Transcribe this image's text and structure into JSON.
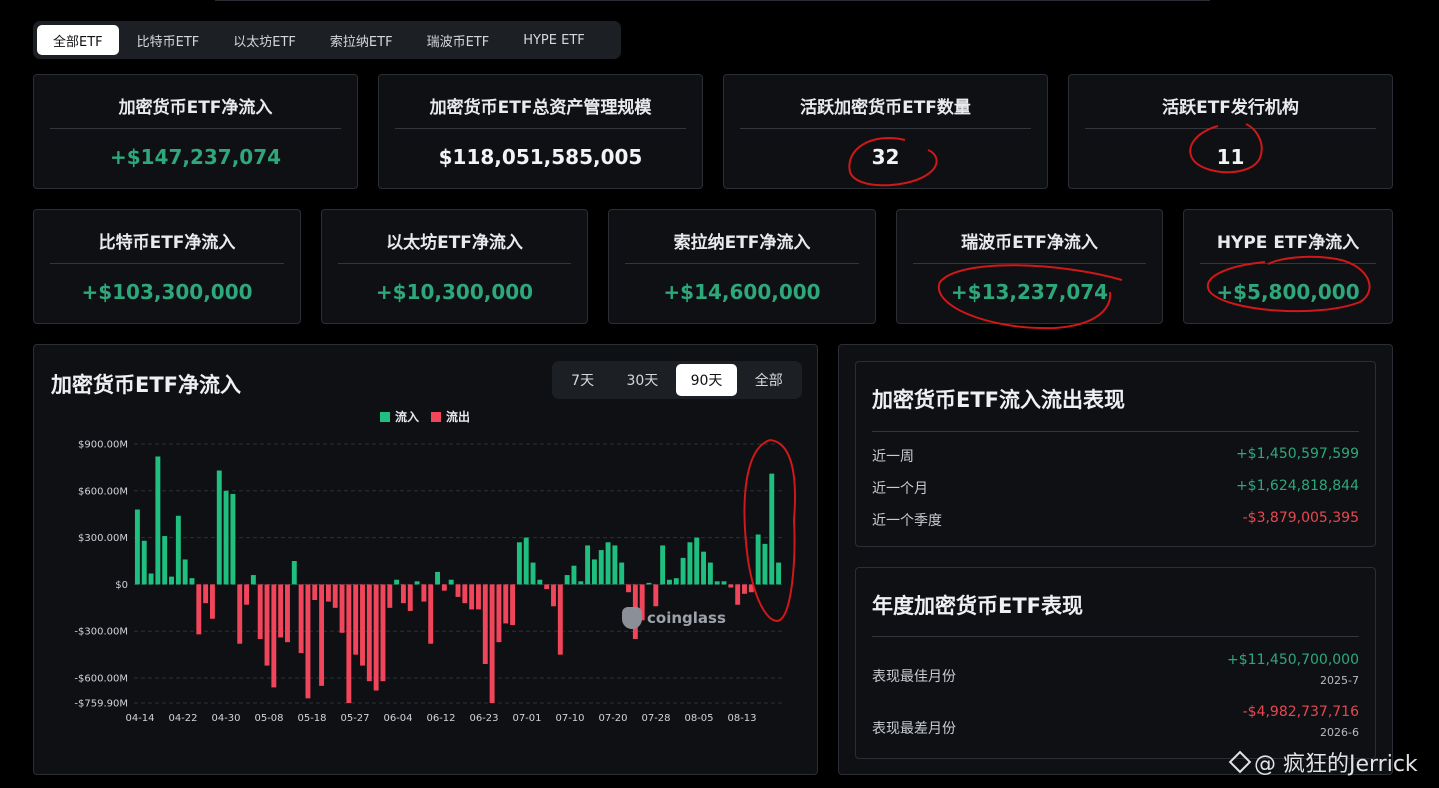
{
  "tabs": [
    {
      "label": "全部ETF",
      "active": true
    },
    {
      "label": "比特币ETF",
      "active": false
    },
    {
      "label": "以太坊ETF",
      "active": false
    },
    {
      "label": "索拉纳ETF",
      "active": false
    },
    {
      "label": "瑞波币ETF",
      "active": false
    },
    {
      "label": "HYPE ETF",
      "active": false
    }
  ],
  "stats_row1": [
    {
      "title": "加密货币ETF净流入",
      "value": "+$147,237,074",
      "positive": true
    },
    {
      "title": "加密货币ETF总资产管理规模",
      "value": "$118,051,585,005",
      "positive": false
    },
    {
      "title": "活跃加密货币ETF数量",
      "value": "32",
      "positive": false
    },
    {
      "title": "活跃ETF发行机构",
      "value": "11",
      "positive": false
    }
  ],
  "stats_row2": [
    {
      "title": "比特币ETF净流入",
      "value": "+$103,300,000"
    },
    {
      "title": "以太坊ETF净流入",
      "value": "+$10,300,000"
    },
    {
      "title": "索拉纳ETF净流入",
      "value": "+$14,600,000"
    },
    {
      "title": "瑞波币ETF净流入",
      "value": "+$13,237,074"
    },
    {
      "title": "HYPE ETF净流入",
      "value": "+$5,800,000"
    }
  ],
  "chart_panel": {
    "title": "加密货币ETF净流入",
    "ranges": [
      {
        "label": "7天",
        "active": false
      },
      {
        "label": "30天",
        "active": false
      },
      {
        "label": "90天",
        "active": true
      },
      {
        "label": "全部",
        "active": false
      }
    ],
    "watermark": "coinglass"
  },
  "chart_data": {
    "type": "bar",
    "legend": [
      {
        "name": "流入",
        "color": "#1fc07f"
      },
      {
        "name": "流出",
        "color": "#f0455a"
      }
    ],
    "unit": "M",
    "ylim": [
      -759.9,
      900
    ],
    "y_ticks": [
      {
        "value": 900,
        "label": "$900.00M"
      },
      {
        "value": 600,
        "label": "$600.00M"
      },
      {
        "value": 300,
        "label": "$300.00M"
      },
      {
        "value": 0,
        "label": "$0"
      },
      {
        "value": -300,
        "label": "-$300.00M"
      },
      {
        "value": -600,
        "label": "-$600.00M"
      },
      {
        "value": -759.9,
        "label": "-$759.90M"
      }
    ],
    "x_ticks": [
      "04-14",
      "04-22",
      "04-30",
      "05-08",
      "05-18",
      "05-27",
      "06-04",
      "06-12",
      "06-23",
      "07-01",
      "07-10",
      "07-20",
      "07-28",
      "08-05",
      "08-13"
    ],
    "grid": true,
    "values": [
      480,
      280,
      70,
      820,
      310,
      50,
      440,
      160,
      40,
      -320,
      -120,
      -220,
      730,
      600,
      580,
      -380,
      -130,
      60,
      -350,
      -520,
      -660,
      -340,
      -370,
      150,
      -440,
      -730,
      -100,
      -650,
      -110,
      -150,
      -310,
      -760,
      -450,
      -520,
      -620,
      -680,
      -620,
      -150,
      30,
      -120,
      -170,
      20,
      -110,
      -380,
      80,
      -40,
      30,
      -80,
      -120,
      -160,
      -160,
      -510,
      -760,
      -370,
      -250,
      -260,
      270,
      300,
      140,
      30,
      -30,
      -140,
      -450,
      60,
      120,
      20,
      250,
      160,
      220,
      270,
      250,
      140,
      -50,
      -350,
      -230,
      10,
      -140,
      250,
      30,
      40,
      170,
      270,
      300,
      210,
      140,
      20,
      20,
      -20,
      -130,
      -60,
      -50,
      320,
      260,
      710,
      140
    ]
  },
  "flow_panel": {
    "title": "加密货币ETF流入流出表现",
    "rows": [
      {
        "label": "近一周",
        "value": "+$1,450,597,599",
        "positive": true
      },
      {
        "label": "近一个月",
        "value": "+$1,624,818,844",
        "positive": true
      },
      {
        "label": "近一个季度",
        "value": "-$3,879,005,395",
        "positive": false
      }
    ]
  },
  "annual_panel": {
    "title": "年度加密货币ETF表现",
    "rows": [
      {
        "label": "表现最佳月份",
        "value": "+$11,450,700,000",
        "period": "2025-7",
        "positive": true
      },
      {
        "label": "表现最差月份",
        "value": "-$4,982,737,716",
        "period": "2026-6",
        "positive": false
      }
    ]
  },
  "footer_watermark": "@ 疯狂的Jerrick",
  "colors": {
    "positive": "#2ea87a",
    "negative": "#e8474f",
    "annotation": "#d01818"
  }
}
